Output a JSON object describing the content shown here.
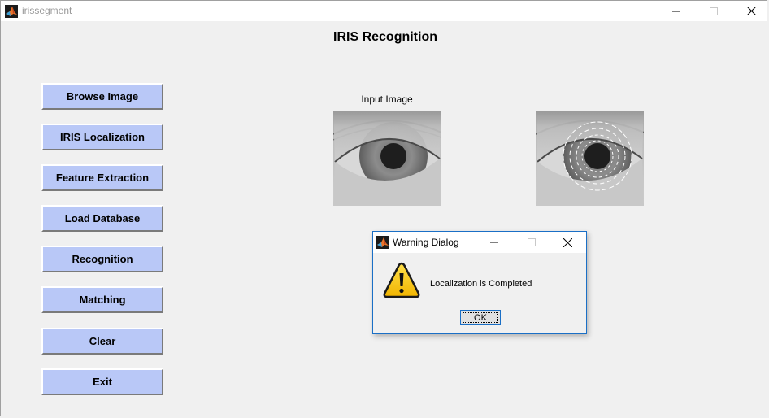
{
  "window": {
    "title": "irissegment",
    "app_icon": "matlab-icon"
  },
  "app": {
    "heading": "IRIS Recognition"
  },
  "buttons": [
    {
      "label": "Browse Image"
    },
    {
      "label": "IRIS Localization"
    },
    {
      "label": "Feature Extraction"
    },
    {
      "label": "Load Database"
    },
    {
      "label": "Recognition"
    },
    {
      "label": "Matching"
    },
    {
      "label": "Clear"
    },
    {
      "label": "Exit"
    }
  ],
  "images": {
    "input_caption": "Input Image"
  },
  "dialog": {
    "title": "Warning Dialog",
    "message": "Localization is Completed",
    "ok_label": "OK",
    "icon": "warning-icon"
  },
  "colors": {
    "button_bg": "#b9c8f7",
    "dialog_border": "#1a6fc6",
    "warning_yellow": "#f5c400"
  }
}
